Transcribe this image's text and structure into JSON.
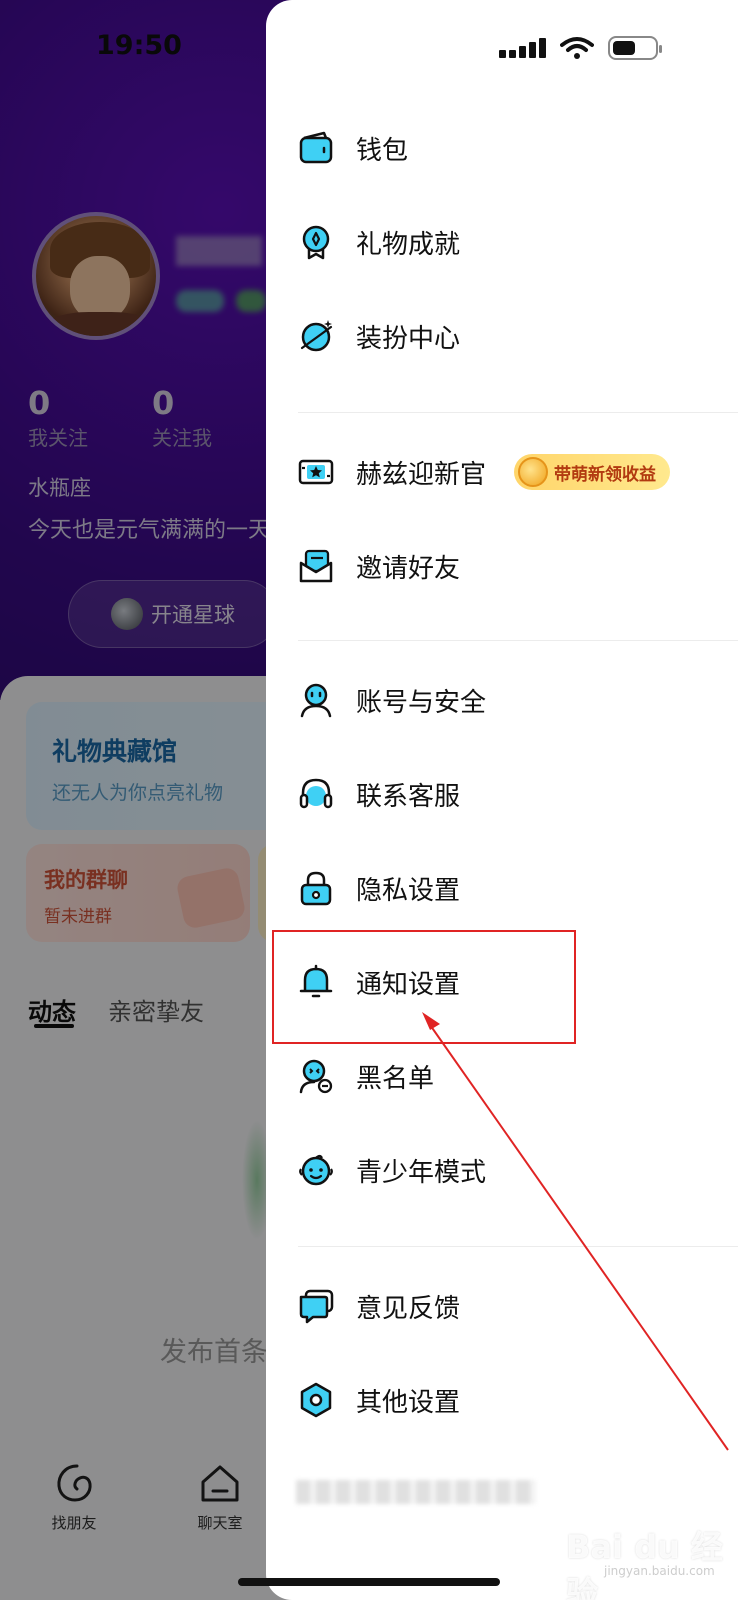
{
  "status_bar": {
    "time": "19:50"
  },
  "profile": {
    "stats": [
      {
        "value": "0",
        "label": "我关注"
      },
      {
        "value": "0",
        "label": "关注我"
      }
    ],
    "zodiac": "水瓶座",
    "bio": "今天也是元气满满的一天",
    "planet_button": "开通星球"
  },
  "cards": {
    "gift_title": "礼物典藏馆",
    "gift_subtitle": "还无人为你点亮礼物",
    "group_title": "我的群聊",
    "group_subtitle": "暂未进群"
  },
  "tabs": [
    "动态",
    "亲密挚友"
  ],
  "publish_hint": "发布首条动态",
  "bottom_nav": [
    {
      "label": "找朋友",
      "icon": "find-friends-icon"
    },
    {
      "label": "聊天室",
      "icon": "chatroom-icon"
    }
  ],
  "drawer": {
    "groups": [
      [
        {
          "label": "钱包",
          "icon": "wallet-icon"
        },
        {
          "label": "礼物成就",
          "icon": "medal-icon"
        },
        {
          "label": "装扮中心",
          "icon": "planet-star-icon"
        }
      ],
      [
        {
          "label": "赫兹迎新官",
          "icon": "ticket-star-icon",
          "badge": "带萌新领收益"
        },
        {
          "label": "邀请好友",
          "icon": "envelope-icon"
        }
      ],
      [
        {
          "label": "账号与安全",
          "icon": "user-face-icon"
        },
        {
          "label": "联系客服",
          "icon": "headset-icon"
        },
        {
          "label": "隐私设置",
          "icon": "lock-icon"
        },
        {
          "label": "通知设置",
          "icon": "bell-icon"
        },
        {
          "label": "黑名单",
          "icon": "user-block-icon"
        },
        {
          "label": "青少年模式",
          "icon": "child-face-icon"
        }
      ],
      [
        {
          "label": "意见反馈",
          "icon": "feedback-icon"
        },
        {
          "label": "其他设置",
          "icon": "hexagon-settings-icon"
        }
      ]
    ]
  },
  "watermark": {
    "text": "Bai du 经验",
    "sub": "jingyan.baidu.com"
  },
  "colors": {
    "accent": "#3fd0f4",
    "highlight": "#e02424",
    "header_purple": "#4a0e9e"
  }
}
